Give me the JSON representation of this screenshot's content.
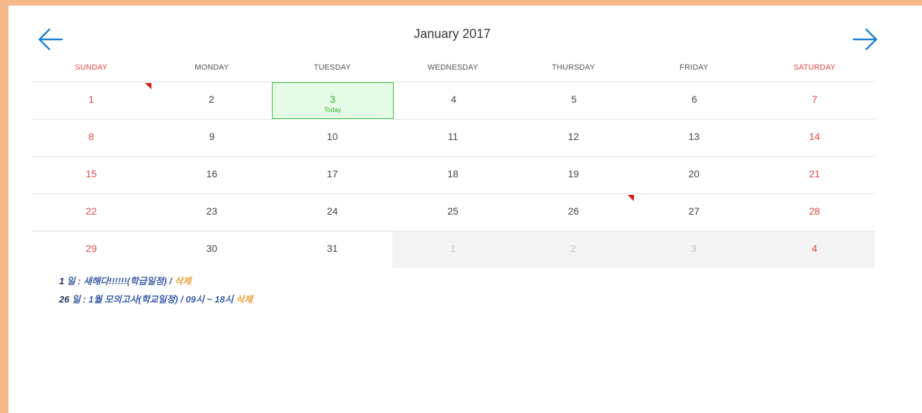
{
  "calendar": {
    "month_title": "January 2017",
    "prev_icon": "arrow-left-icon",
    "next_icon": "arrow-right-icon",
    "arrow_color": "#1a7fd4",
    "weekdays": [
      "SUNDAY",
      "MONDAY",
      "TUESDAY",
      "WEDNESDAY",
      "THURSDAY",
      "FRIDAY",
      "SATURDAY"
    ],
    "today_label": "Today",
    "weeks": [
      [
        "1",
        "2",
        "3",
        "4",
        "5",
        "6",
        "7"
      ],
      [
        "8",
        "9",
        "10",
        "11",
        "12",
        "13",
        "14"
      ],
      [
        "15",
        "16",
        "17",
        "18",
        "19",
        "20",
        "21"
      ],
      [
        "22",
        "23",
        "24",
        "25",
        "26",
        "27",
        "28"
      ],
      [
        "29",
        "30",
        "31",
        "1",
        "2",
        "3",
        "4"
      ]
    ]
  },
  "events": [
    {
      "day": "1",
      "text": " 일 : 새해다!!!!!!(학급일정) / ",
      "delete_label": "삭제"
    },
    {
      "day": "26",
      "text": " 일 : 1월 모의고사(학교일정) / 09시 ~ 18시 ",
      "delete_label": "삭제"
    }
  ],
  "colors": {
    "weekend": "#e04545",
    "today_border": "#34c43e",
    "today_bg": "#e6fbe6",
    "event_flag": "#e01818",
    "page_border": "#f7b98c"
  }
}
